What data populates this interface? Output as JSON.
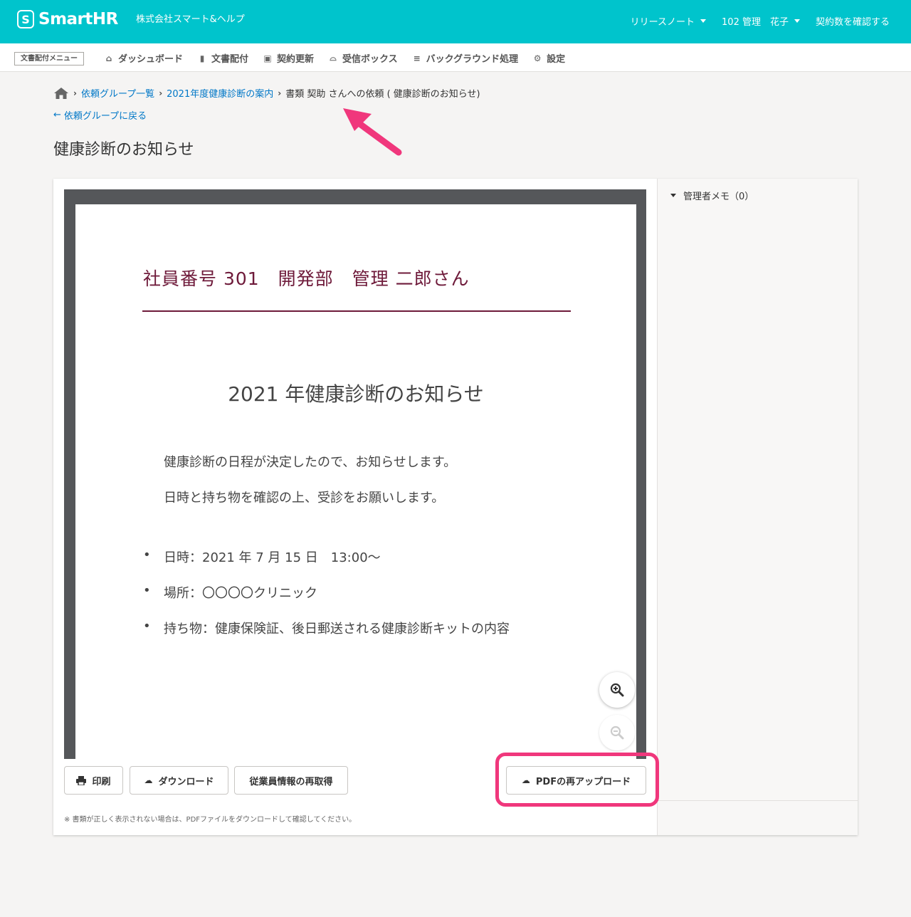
{
  "header": {
    "brand": "SmartHR",
    "brand_mark": "S",
    "company": "株式会社スマート&ヘルプ",
    "release_notes": "リリースノート",
    "user": "102 管理　花子",
    "contract": "契約数を確認する"
  },
  "subnav": {
    "menu_tag": "文書配付メニュー",
    "items": [
      {
        "label": "ダッシュボード",
        "icon": "home-icon"
      },
      {
        "label": "文書配付",
        "icon": "file-icon"
      },
      {
        "label": "契約更新",
        "icon": "calendar-check-icon"
      },
      {
        "label": "受信ボックス",
        "icon": "inbox-icon"
      },
      {
        "label": "バックグラウンド処理",
        "icon": "database-icon"
      },
      {
        "label": "設定",
        "icon": "gear-icon"
      }
    ]
  },
  "breadcrumb": {
    "items": [
      "依頼グループ一覧",
      "2021年度健康診断の案内"
    ],
    "current": "書類 契助 さんへの依頼 ( 健康診断のお知らせ)"
  },
  "back_link": "依頼グループに戻る",
  "page_title": "健康診断のお知らせ",
  "document": {
    "header": "社員番号 301　開発部　管理 二郎さん",
    "title": "2021 年健康診断のお知らせ",
    "paragraphs": [
      "健康診断の日程が決定したので、お知らせします。",
      "日時と持ち物を確認の上、受診をお願いします。"
    ],
    "list": [
      "日時：2021 年 7 月 15 日　13:00～",
      "場所：〇〇〇〇クリニック",
      "持ち物：健康保険証、後日郵送される健康診断キットの内容"
    ],
    "bullet": "•"
  },
  "side": {
    "memo_title": "管理者メモ（0）"
  },
  "buttons": {
    "print": "印刷",
    "download": "ダウンロード",
    "refetch": "従業員情報の再取得",
    "reupload": "PDFの再アップロード"
  },
  "note": "※ 書類が正しく表示されない場合は、PDFファイルをダウンロードして確認してください。",
  "colors": {
    "header": "#00c4cc",
    "link": "#0077c7",
    "doc_accent": "#6e1a3a",
    "annotation": "#f0377c"
  }
}
